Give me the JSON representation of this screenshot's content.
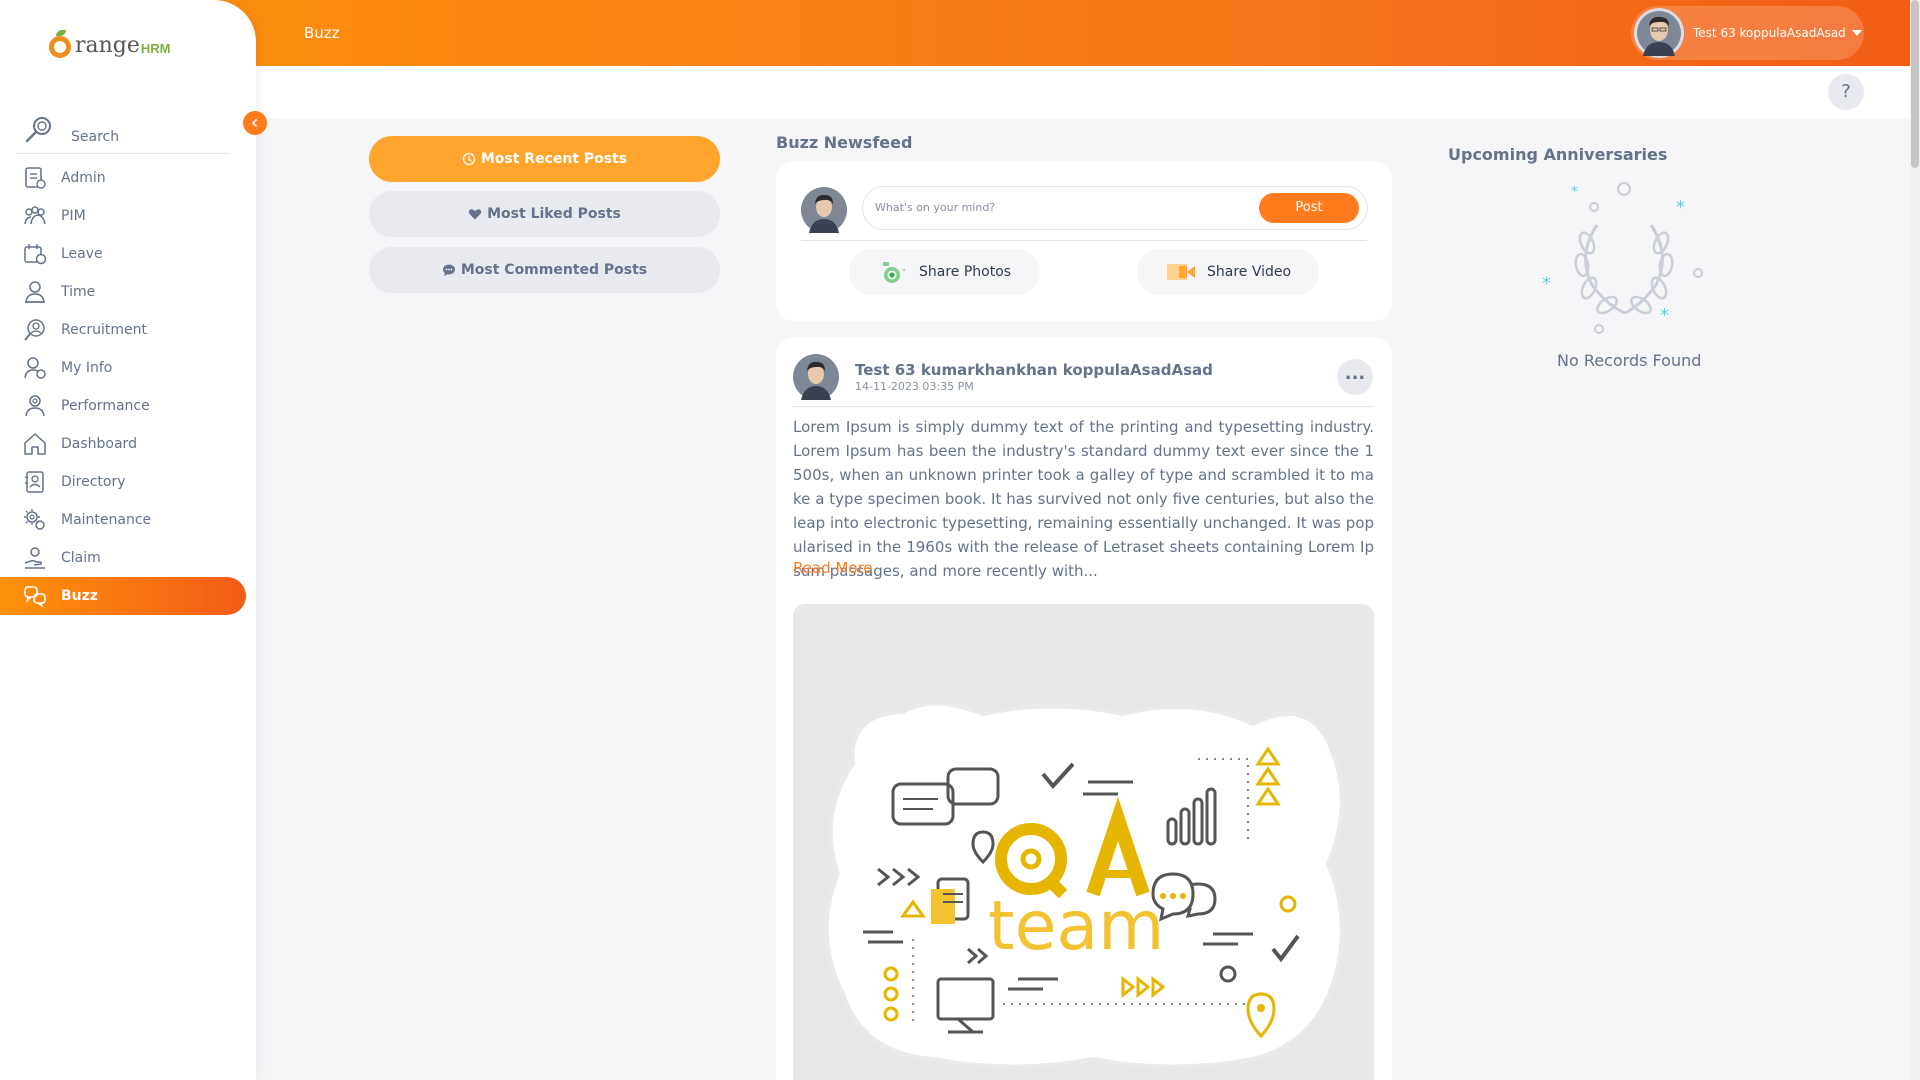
{
  "brand": {
    "name": "range",
    "suffix": "HRM",
    "leaf_color": "#7bb13c",
    "orange": "#f28c1e"
  },
  "topbar": {
    "title": "Buzz",
    "user_name": "Test 63 koppulaAsadAsad"
  },
  "sidebar": {
    "search_label": "Search",
    "items": [
      {
        "label": "Admin",
        "icon": "admin-icon"
      },
      {
        "label": "PIM",
        "icon": "pim-icon"
      },
      {
        "label": "Leave",
        "icon": "leave-icon"
      },
      {
        "label": "Time",
        "icon": "time-icon"
      },
      {
        "label": "Recruitment",
        "icon": "recruitment-icon"
      },
      {
        "label": "My Info",
        "icon": "my-info-icon"
      },
      {
        "label": "Performance",
        "icon": "performance-icon"
      },
      {
        "label": "Dashboard",
        "icon": "dashboard-icon"
      },
      {
        "label": "Directory",
        "icon": "directory-icon"
      },
      {
        "label": "Maintenance",
        "icon": "maintenance-icon"
      },
      {
        "label": "Claim",
        "icon": "claim-icon"
      },
      {
        "label": "Buzz",
        "icon": "buzz-icon",
        "active": true
      }
    ]
  },
  "help_label": "?",
  "filters": {
    "most_recent": "Most Recent Posts",
    "most_liked": "Most Liked Posts",
    "most_commented": "Most Commented Posts"
  },
  "newsfeed": {
    "title": "Buzz Newsfeed",
    "compose_placeholder": "What's on your mind?",
    "post_button": "Post",
    "share_photos": "Share Photos",
    "share_video": "Share Video"
  },
  "post": {
    "author": "Test 63 kumarkhankhan koppulaAsadAsad",
    "date": "14-11-2023 03:35 PM",
    "more_label": "...",
    "body": "Lorem Ipsum is simply dummy text of the printing and typesetting industry. Lorem Ipsum has been the industry's standard dummy text ever since the 1500s, when an unknown printer took a galley of type and scrambled it to make a type specimen book. It has survived not only five centuries, but also the leap into electronic typesetting, remaining essentially unchanged. It was popularised in the 1960s with the release of Letraset sheets containing Lorem Ipsum passages, and more recently with...",
    "read_more": "Read More",
    "image_text": {
      "q": "Q",
      "a": "A",
      "team": "team"
    }
  },
  "anniversaries": {
    "title": "Upcoming Anniversaries",
    "empty": "No Records Found"
  },
  "colors": {
    "accent": "#ff7b1d",
    "accent_light": "#ffa52d",
    "text": "#64728c",
    "bg": "#f6f6f9"
  }
}
